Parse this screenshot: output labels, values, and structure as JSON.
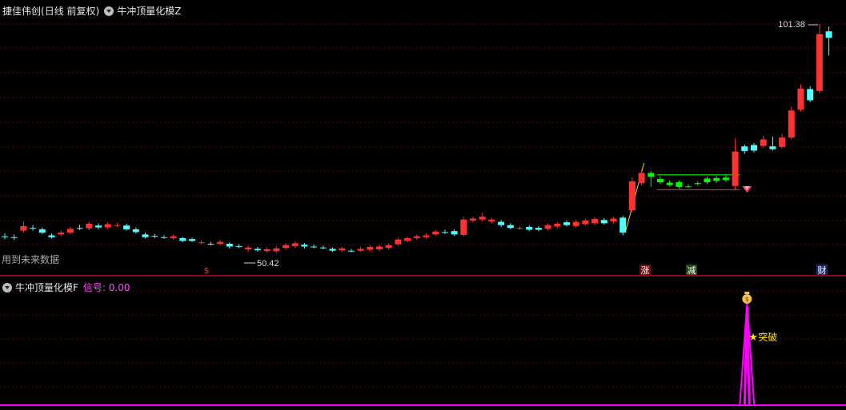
{
  "main": {
    "stock_name": "捷佳伟创",
    "period_label": "(日线 前复权)",
    "indicator_name": "牛冲顶量化模Z",
    "high_price_label": "101.38",
    "low_price_label": "50.42",
    "future_data_note": "用到未来数据",
    "markers": [
      "$",
      "涨",
      "减",
      "财"
    ]
  },
  "indicator": {
    "name": "牛冲顶量化模F",
    "signal_label": "信号: 0.00",
    "breakout_label": "突破"
  },
  "colors": {
    "up": "#ff3232",
    "down": "#54ffff",
    "highlight": "#00ff00",
    "grid": "#5a0a0a",
    "signal": "#ff00ff",
    "background": "#000000"
  },
  "chart_data": {
    "type": "candlestick",
    "low_label": 50.42,
    "high_label": 101.38,
    "candles": [
      {
        "o": 55.8,
        "c": 55.8,
        "h": 56.4,
        "l": 55.2,
        "color": "down"
      },
      {
        "o": 55.6,
        "c": 55.6,
        "h": 56.2,
        "l": 55.0,
        "color": "down"
      },
      {
        "o": 57.0,
        "c": 58.0,
        "h": 59.0,
        "l": 56.6,
        "color": "up"
      },
      {
        "o": 57.6,
        "c": 57.6,
        "h": 58.2,
        "l": 57.0,
        "color": "down"
      },
      {
        "o": 57.3,
        "c": 56.6,
        "h": 57.7,
        "l": 56.3,
        "color": "down"
      },
      {
        "o": 56.0,
        "c": 55.6,
        "h": 56.4,
        "l": 55.3,
        "color": "down"
      },
      {
        "o": 56.2,
        "c": 56.6,
        "h": 57.0,
        "l": 55.8,
        "color": "up"
      },
      {
        "o": 56.6,
        "c": 57.4,
        "h": 57.8,
        "l": 56.2,
        "color": "up"
      },
      {
        "o": 57.6,
        "c": 57.6,
        "h": 58.3,
        "l": 57.1,
        "color": "down"
      },
      {
        "o": 57.5,
        "c": 58.5,
        "h": 58.9,
        "l": 57.1,
        "color": "up"
      },
      {
        "o": 58.1,
        "c": 57.7,
        "h": 58.6,
        "l": 57.3,
        "color": "down"
      },
      {
        "o": 57.7,
        "c": 58.4,
        "h": 58.8,
        "l": 57.3,
        "color": "up"
      },
      {
        "o": 58.2,
        "c": 58.2,
        "h": 58.7,
        "l": 57.8,
        "color": "up"
      },
      {
        "o": 58.1,
        "c": 57.3,
        "h": 58.5,
        "l": 57.0,
        "color": "down"
      },
      {
        "o": 57.3,
        "c": 56.7,
        "h": 57.7,
        "l": 56.4,
        "color": "down"
      },
      {
        "o": 56.2,
        "c": 55.6,
        "h": 56.6,
        "l": 55.3,
        "color": "down"
      },
      {
        "o": 55.9,
        "c": 55.9,
        "h": 56.3,
        "l": 55.4,
        "color": "down"
      },
      {
        "o": 55.6,
        "c": 55.6,
        "h": 56.0,
        "l": 55.3,
        "color": "down"
      },
      {
        "o": 55.4,
        "c": 55.8,
        "h": 56.2,
        "l": 55.1,
        "color": "up"
      },
      {
        "o": 55.4,
        "c": 54.8,
        "h": 55.7,
        "l": 54.5,
        "color": "down"
      },
      {
        "o": 55.2,
        "c": 54.8,
        "h": 55.5,
        "l": 54.6,
        "color": "down"
      },
      {
        "o": 54.5,
        "c": 54.5,
        "h": 55.0,
        "l": 54.1,
        "color": "up"
      },
      {
        "o": 54.2,
        "c": 54.2,
        "h": 54.6,
        "l": 53.8,
        "color": "down"
      },
      {
        "o": 54.2,
        "c": 54.6,
        "h": 55.0,
        "l": 53.9,
        "color": "up"
      },
      {
        "o": 54.2,
        "c": 53.6,
        "h": 54.5,
        "l": 53.2,
        "color": "down"
      },
      {
        "o": 53.7,
        "c": 53.7,
        "h": 54.1,
        "l": 53.3,
        "color": "down"
      },
      {
        "o": 53.0,
        "c": 53.4,
        "h": 53.8,
        "l": 52.5,
        "color": "up"
      },
      {
        "o": 53.1,
        "c": 52.8,
        "h": 53.5,
        "l": 52.5,
        "color": "down"
      },
      {
        "o": 52.6,
        "c": 53.0,
        "h": 53.4,
        "l": 52.3,
        "color": "up"
      },
      {
        "o": 52.6,
        "c": 53.2,
        "h": 53.6,
        "l": 52.2,
        "color": "up"
      },
      {
        "o": 53.3,
        "c": 53.9,
        "h": 54.3,
        "l": 52.9,
        "color": "up"
      },
      {
        "o": 53.7,
        "c": 54.3,
        "h": 54.7,
        "l": 53.3,
        "color": "up"
      },
      {
        "o": 54.0,
        "c": 53.6,
        "h": 54.4,
        "l": 53.2,
        "color": "down"
      },
      {
        "o": 53.6,
        "c": 53.6,
        "h": 54.0,
        "l": 53.2,
        "color": "down"
      },
      {
        "o": 53.4,
        "c": 53.4,
        "h": 53.8,
        "l": 53.0,
        "color": "down"
      },
      {
        "o": 53.1,
        "c": 52.7,
        "h": 53.4,
        "l": 52.4,
        "color": "down"
      },
      {
        "o": 52.8,
        "c": 53.2,
        "h": 53.5,
        "l": 52.4,
        "color": "up"
      },
      {
        "o": 52.7,
        "c": 52.7,
        "h": 53.1,
        "l": 52.4,
        "color": "down"
      },
      {
        "o": 52.7,
        "c": 53.1,
        "h": 53.5,
        "l": 52.4,
        "color": "up"
      },
      {
        "o": 52.9,
        "c": 53.5,
        "h": 53.9,
        "l": 52.5,
        "color": "up"
      },
      {
        "o": 53.0,
        "c": 53.6,
        "h": 54.0,
        "l": 52.6,
        "color": "up"
      },
      {
        "o": 53.3,
        "c": 53.9,
        "h": 54.3,
        "l": 52.9,
        "color": "up"
      },
      {
        "o": 54.1,
        "c": 55.1,
        "h": 55.5,
        "l": 53.7,
        "color": "up"
      },
      {
        "o": 54.8,
        "c": 55.4,
        "h": 55.8,
        "l": 54.5,
        "color": "up"
      },
      {
        "o": 55.4,
        "c": 55.8,
        "h": 56.2,
        "l": 55.0,
        "color": "up"
      },
      {
        "o": 55.6,
        "c": 56.0,
        "h": 56.4,
        "l": 55.3,
        "color": "up"
      },
      {
        "o": 56.2,
        "c": 56.8,
        "h": 57.2,
        "l": 55.9,
        "color": "up"
      },
      {
        "o": 56.7,
        "c": 56.7,
        "h": 57.2,
        "l": 56.3,
        "color": "down"
      },
      {
        "o": 56.9,
        "c": 56.2,
        "h": 57.3,
        "l": 55.9,
        "color": "down"
      },
      {
        "o": 56.1,
        "c": 59.4,
        "h": 60.0,
        "l": 55.8,
        "color": "up"
      },
      {
        "o": 59.2,
        "c": 59.6,
        "h": 60.0,
        "l": 58.8,
        "color": "up"
      },
      {
        "o": 59.4,
        "c": 60.0,
        "h": 60.8,
        "l": 59.0,
        "color": "up"
      },
      {
        "o": 59.4,
        "c": 59.0,
        "h": 59.8,
        "l": 58.6,
        "color": "up"
      },
      {
        "o": 58.9,
        "c": 58.2,
        "h": 59.3,
        "l": 57.8,
        "color": "down"
      },
      {
        "o": 58.2,
        "c": 57.6,
        "h": 58.6,
        "l": 57.3,
        "color": "down"
      },
      {
        "o": 57.6,
        "c": 57.6,
        "h": 58.0,
        "l": 57.2,
        "color": "up"
      },
      {
        "o": 57.8,
        "c": 57.2,
        "h": 58.2,
        "l": 56.9,
        "color": "down"
      },
      {
        "o": 57.2,
        "c": 57.6,
        "h": 58.0,
        "l": 56.9,
        "color": "down"
      },
      {
        "o": 57.4,
        "c": 58.2,
        "h": 58.6,
        "l": 57.0,
        "color": "up"
      },
      {
        "o": 57.9,
        "c": 58.5,
        "h": 58.9,
        "l": 57.5,
        "color": "up"
      },
      {
        "o": 58.8,
        "c": 58.2,
        "h": 59.2,
        "l": 57.9,
        "color": "down"
      },
      {
        "o": 58.0,
        "c": 58.9,
        "h": 59.3,
        "l": 57.7,
        "color": "up"
      },
      {
        "o": 58.4,
        "c": 59.2,
        "h": 59.6,
        "l": 58.1,
        "color": "up"
      },
      {
        "o": 58.6,
        "c": 59.5,
        "h": 59.9,
        "l": 58.2,
        "color": "up"
      },
      {
        "o": 59.3,
        "c": 58.6,
        "h": 59.7,
        "l": 58.3,
        "color": "down"
      },
      {
        "o": 59.0,
        "c": 59.6,
        "h": 60.0,
        "l": 58.6,
        "color": "up"
      },
      {
        "o": 59.8,
        "c": 56.6,
        "h": 60.2,
        "l": 56.0,
        "color": "down"
      },
      {
        "o": 61.4,
        "c": 67.6,
        "h": 68.4,
        "l": 61.0,
        "color": "up"
      },
      {
        "o": 67.2,
        "c": 69.4,
        "h": 70.2,
        "l": 66.7,
        "color": "up"
      },
      {
        "o": 68.6,
        "c": 69.4,
        "h": 69.8,
        "l": 66.4,
        "color": "hl"
      },
      {
        "o": 68.1,
        "c": 67.4,
        "h": 68.6,
        "l": 67.0,
        "color": "hl"
      },
      {
        "o": 66.8,
        "c": 67.3,
        "h": 67.8,
        "l": 66.5,
        "color": "hl"
      },
      {
        "o": 66.4,
        "c": 67.4,
        "h": 67.8,
        "l": 66.0,
        "color": "hl"
      },
      {
        "o": 66.5,
        "c": 66.5,
        "h": 67.0,
        "l": 66.2,
        "color": "hl"
      },
      {
        "o": 67.2,
        "c": 67.0,
        "h": 67.6,
        "l": 66.7,
        "color": "hl"
      },
      {
        "o": 67.4,
        "c": 68.2,
        "h": 68.6,
        "l": 67.0,
        "color": "hl"
      },
      {
        "o": 67.7,
        "c": 68.3,
        "h": 68.7,
        "l": 67.3,
        "color": "hl"
      },
      {
        "o": 68.4,
        "c": 67.9,
        "h": 68.9,
        "l": 67.5,
        "color": "hl"
      },
      {
        "o": 66.6,
        "c": 74.0,
        "h": 76.8,
        "l": 65.8,
        "color": "up"
      },
      {
        "o": 74.1,
        "c": 75.1,
        "h": 75.5,
        "l": 73.5,
        "color": "down"
      },
      {
        "o": 75.4,
        "c": 74.2,
        "h": 75.8,
        "l": 73.8,
        "color": "down"
      },
      {
        "o": 75.2,
        "c": 76.6,
        "h": 77.4,
        "l": 74.8,
        "color": "up"
      },
      {
        "o": 75.1,
        "c": 74.5,
        "h": 77.2,
        "l": 74.2,
        "color": "down"
      },
      {
        "o": 75.0,
        "c": 77.0,
        "h": 77.8,
        "l": 74.6,
        "color": "up"
      },
      {
        "o": 77.0,
        "c": 82.8,
        "h": 83.6,
        "l": 76.6,
        "color": "up"
      },
      {
        "o": 83.0,
        "c": 87.5,
        "h": 88.4,
        "l": 82.6,
        "color": "up"
      },
      {
        "o": 85.0,
        "c": 87.4,
        "h": 88.0,
        "l": 84.6,
        "color": "down"
      },
      {
        "o": 87.0,
        "c": 99.2,
        "h": 101.38,
        "l": 86.5,
        "color": "up"
      },
      {
        "o": 99.8,
        "c": 98.4,
        "h": 100.8,
        "l": 94.6,
        "color": "down"
      }
    ],
    "zones": {
      "box_start_index": 70,
      "box_end_index": 78,
      "box_top": 69.0,
      "box_bottom": 65.8
    },
    "indicator_signal": {
      "baseline": 0,
      "peak": 1,
      "peak_index": 79,
      "current_value": 0.0
    }
  }
}
